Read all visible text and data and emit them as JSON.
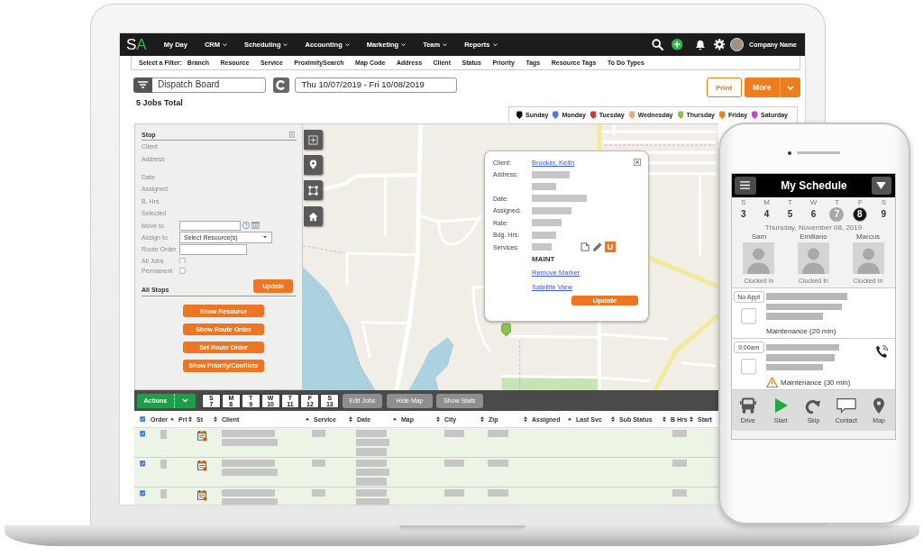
{
  "nav": {
    "logo": "SA",
    "items": [
      {
        "label": "My Day",
        "dropdown": false
      },
      {
        "label": "CRM",
        "dropdown": true
      },
      {
        "label": "Scheduling",
        "dropdown": true
      },
      {
        "label": "Accounting",
        "dropdown": true
      },
      {
        "label": "Marketing",
        "dropdown": true
      },
      {
        "label": "Team",
        "dropdown": true
      },
      {
        "label": "Reports",
        "dropdown": true
      }
    ],
    "account": "Company Name"
  },
  "filter_bar": {
    "title": "Select a Filter:",
    "items": [
      "Branch",
      "Resource",
      "Service",
      "ProximitySearch",
      "Map Code",
      "Address",
      "Client",
      "Status",
      "Priority",
      "Tags",
      "Resource Tags",
      "To Do Types"
    ]
  },
  "board": {
    "view": "Dispatch Board",
    "date_range": "Thu 10/07/2019 - Fri 10/08/2019",
    "buttons": [
      {
        "label": "Print",
        "kind": "outline"
      },
      {
        "label": "More",
        "kind": "split"
      }
    ],
    "jobs_total": "5 Jobs Total"
  },
  "legend": [
    {
      "label": "Sunday",
      "color": "#111111"
    },
    {
      "label": "Monday",
      "color": "#4a7bd9"
    },
    {
      "label": "Tuesday",
      "color": "#d8333c"
    },
    {
      "label": "Wednesday",
      "color": "#f4a46c"
    },
    {
      "label": "Thursday",
      "color": "#8cc152"
    },
    {
      "label": "Friday",
      "color": "#ee7d1e"
    },
    {
      "label": "Saturday",
      "color": "#c340c8"
    }
  ],
  "stop_panel": {
    "title": "Stop",
    "info": [
      "Client",
      "Address",
      "Date",
      "Assigned",
      "B. Hrs",
      "Selected"
    ],
    "form": [
      {
        "label": "Move to",
        "kind": "date"
      },
      {
        "label": "Assign to",
        "kind": "select",
        "value": "Select Resource(s)"
      },
      {
        "label": "Route Order",
        "kind": "text"
      },
      {
        "label": "All Jobs",
        "kind": "checkbox",
        "checked": false
      },
      {
        "label": "Permanent",
        "kind": "checkbox",
        "checked": false
      }
    ],
    "update": "Update",
    "section": "All Stops",
    "actions": [
      "Show Resource",
      "Show Route Order",
      "Set Route Order",
      "Show Priority/Conflicts"
    ]
  },
  "map": {
    "popup": {
      "fields": [
        {
          "label": "Client:",
          "kind": "link",
          "value": "Brooker, Keith"
        },
        {
          "label": "Address:",
          "kind": "redacted"
        },
        {
          "kind": "redacted"
        },
        {
          "label": "Date:",
          "kind": "redacted"
        },
        {
          "label": "Assigned:",
          "kind": "redacted"
        },
        {
          "label": "Rate:",
          "kind": "redacted"
        },
        {
          "label": "Bdg. Hrs:",
          "kind": "redacted"
        },
        {
          "label": "Services:",
          "kind": "service"
        }
      ],
      "badge": "U",
      "service": "MAINT",
      "links": [
        "Remove Marker",
        "Satellite View"
      ],
      "button": "Update"
    }
  },
  "toolbar": {
    "actions": "Actions",
    "days": [
      {
        "letter": "S",
        "date": "7"
      },
      {
        "letter": "M",
        "date": "8"
      },
      {
        "letter": "T",
        "date": "9"
      },
      {
        "letter": "W",
        "date": "10"
      },
      {
        "letter": "T",
        "date": "11"
      },
      {
        "letter": "F",
        "date": "12"
      },
      {
        "letter": "S",
        "date": "13"
      }
    ],
    "buttons": [
      "Edit Jobs",
      "Hide Map",
      "Show Stats"
    ]
  },
  "table": {
    "all_checked": true,
    "columns": [
      {
        "label": "Order",
        "sorted": true,
        "kind": "bar"
      },
      {
        "label": "Pri",
        "sorted": false,
        "kind": "empty"
      },
      {
        "label": "St",
        "sorted": false,
        "kind": "status"
      },
      {
        "label": "Client",
        "sorted": true,
        "kind": "lines"
      },
      {
        "label": "Service",
        "sorted": false,
        "kind": "bar"
      },
      {
        "label": "Date",
        "sorted": true,
        "kind": "stack"
      },
      {
        "label": "Map",
        "sorted": false,
        "kind": "empty"
      },
      {
        "label": "City",
        "sorted": false,
        "kind": "bar"
      },
      {
        "label": "Zip",
        "sorted": false,
        "kind": "bar"
      },
      {
        "label": "Assigned",
        "sorted": true,
        "kind": "empty"
      },
      {
        "label": "Last Svc",
        "sorted": false,
        "kind": "empty"
      },
      {
        "label": "Sub Status",
        "sorted": false,
        "kind": "empty"
      },
      {
        "label": "B Hrs",
        "sorted": false,
        "kind": "bar"
      },
      {
        "label": "Start",
        "kind": "empty"
      }
    ],
    "rows": [
      {
        "checked": true
      },
      {
        "checked": true
      },
      {
        "checked": true
      }
    ]
  },
  "phone": {
    "title": "My Schedule",
    "week": [
      {
        "letter": "S",
        "date": "3",
        "today": false,
        "selected": false
      },
      {
        "letter": "M",
        "date": "4",
        "today": false,
        "selected": false
      },
      {
        "letter": "T",
        "date": "5",
        "today": false,
        "selected": false
      },
      {
        "letter": "W",
        "date": "6",
        "today": false,
        "selected": false
      },
      {
        "letter": "T",
        "date": "7",
        "today": true,
        "selected": false
      },
      {
        "letter": "F",
        "date": "8",
        "today": false,
        "selected": true
      },
      {
        "letter": "S",
        "date": "9",
        "today": false,
        "selected": false
      }
    ],
    "date": "Thursday, November 08, 2019",
    "techs": [
      {
        "name": "Sam",
        "status": "Clocked In"
      },
      {
        "name": "Emiliano",
        "status": "Clocked In"
      },
      {
        "name": "Marcus",
        "status": "Clocked In"
      }
    ],
    "appointments": [
      {
        "time": "No Appt",
        "service": "Maintenance (20 min)",
        "checked": false,
        "warning": false,
        "call": false
      },
      {
        "time": "9:00am",
        "service": "Maintenance (30 min)",
        "checked": false,
        "warning": true,
        "call": true
      }
    ],
    "nav": [
      {
        "label": "Drive",
        "kind": "drive"
      },
      {
        "label": "Start",
        "kind": "start"
      },
      {
        "label": "Skip",
        "kind": "skip"
      },
      {
        "label": "Contact",
        "kind": "contact"
      },
      {
        "label": "Map",
        "kind": "map"
      }
    ]
  }
}
